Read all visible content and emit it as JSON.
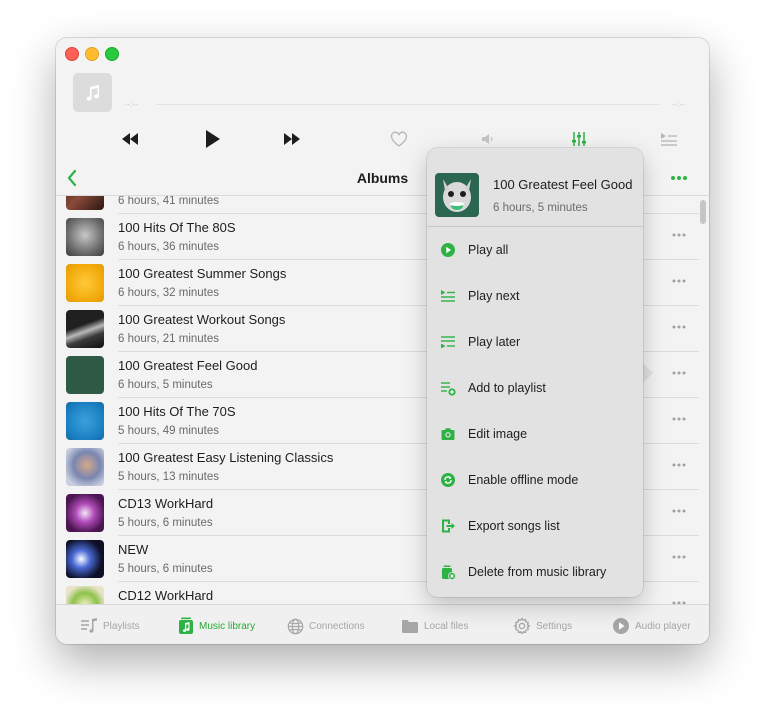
{
  "player": {
    "elapsed": "--:--",
    "remaining": "--:--"
  },
  "header": {
    "title": "Albums"
  },
  "albums": [
    {
      "name": "",
      "duration": "6 hours, 41 minutes"
    },
    {
      "name": "100 Hits Of The 80S",
      "duration": "6 hours, 36 minutes"
    },
    {
      "name": "100 Greatest Summer Songs",
      "duration": "6 hours, 32 minutes"
    },
    {
      "name": "100 Greatest Workout Songs",
      "duration": "6 hours, 21 minutes"
    },
    {
      "name": "100 Greatest Feel Good",
      "duration": "6 hours, 5 minutes"
    },
    {
      "name": "100 Hits Of The 70S",
      "duration": "5 hours, 49 minutes"
    },
    {
      "name": "100 Greatest Easy Listening Classics",
      "duration": "5 hours, 13 minutes"
    },
    {
      "name": "CD13 WorkHard",
      "duration": "5 hours, 6 minutes"
    },
    {
      "name": "NEW",
      "duration": "5 hours, 6 minutes"
    },
    {
      "name": "CD12 WorkHard",
      "duration": ""
    }
  ],
  "popover": {
    "title": "100 Greatest Feel Good",
    "subtitle": "6 hours, 5 minutes",
    "items": [
      {
        "label": "Play all",
        "icon": "play-circle-icon"
      },
      {
        "label": "Play next",
        "icon": "play-next-icon"
      },
      {
        "label": "Play later",
        "icon": "play-later-icon"
      },
      {
        "label": "Add to playlist",
        "icon": "add-to-playlist-icon"
      },
      {
        "label": "Edit image",
        "icon": "camera-icon"
      },
      {
        "label": "Enable offline mode",
        "icon": "offline-sync-icon"
      },
      {
        "label": "Export songs list",
        "icon": "export-icon"
      },
      {
        "label": "Delete from music library",
        "icon": "delete-folder-icon"
      }
    ]
  },
  "tabs": [
    {
      "label": "Playlists",
      "icon": "playlists-icon",
      "active": false
    },
    {
      "label": "Music library",
      "icon": "music-library-icon",
      "active": true
    },
    {
      "label": "Connections",
      "icon": "globe-icon",
      "active": false
    },
    {
      "label": "Local files",
      "icon": "folder-icon",
      "active": false
    },
    {
      "label": "Settings",
      "icon": "gear-icon",
      "active": false
    },
    {
      "label": "Audio player",
      "icon": "play-icon",
      "active": false
    }
  ],
  "colors": {
    "accent": "#2fb245",
    "text": "#1d1d1f",
    "secondary": "#6a6a6a"
  }
}
